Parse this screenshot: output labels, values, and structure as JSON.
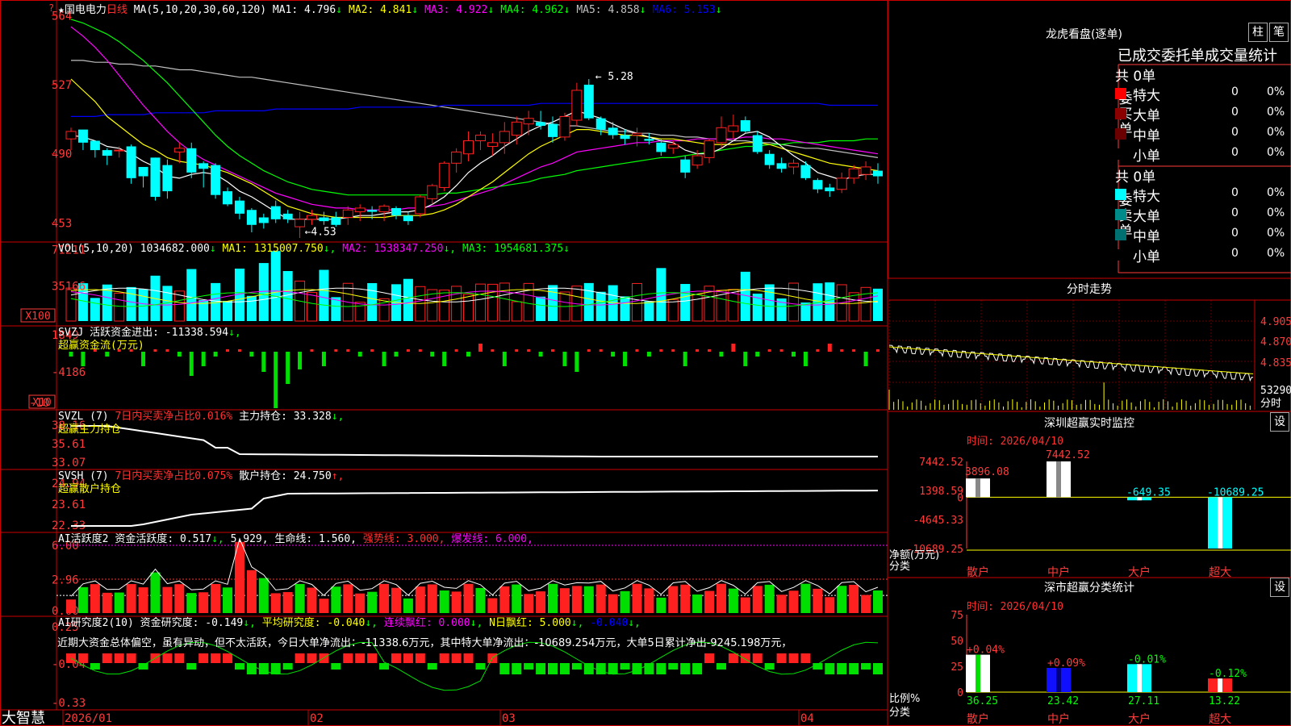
{
  "colors": {
    "up": "#ff2020",
    "down": "#00ffff",
    "grid": "#cc0000",
    "ma1": "#ffffff",
    "ma2": "#ffff00",
    "ma3": "#ff00ff",
    "ma4": "#00ff00",
    "ma5": "#c0c0c0",
    "ma6": "#0000ff"
  },
  "header": {
    "star": "★",
    "stock_name": "国电电力",
    "period": "日线",
    "ma_params": "MA(5,10,20,30,60,120)",
    "ma_values": [
      {
        "label": "MA1:",
        "value": "4.796",
        "arrow": "↓"
      },
      {
        "label": "MA2:",
        "value": "4.841",
        "arrow": "↓"
      },
      {
        "label": "MA3:",
        "value": "4.922",
        "arrow": "↓"
      },
      {
        "label": "MA4:",
        "value": "4.962",
        "arrow": "↓"
      },
      {
        "label": "MA5:",
        "value": "4.858",
        "arrow": "↓"
      },
      {
        "label": "MA6:",
        "value": "5.153",
        "arrow": "↓"
      }
    ]
  },
  "price_axis": [
    "564",
    "527",
    "490",
    "453"
  ],
  "high_label": "5.28",
  "low_label": "4.53",
  "vol": {
    "title": "VOL(5,10,20)",
    "value": "1034682.000",
    "ma1": "1315007.750",
    "ma2": "1538347.250",
    "ma3": "1954681.375",
    "axis": [
      "71211",
      "35166"
    ],
    "unit": "X100"
  },
  "svzj": {
    "title": "SVZJ",
    "label": "活跃资金进出:",
    "value": "-11338.594",
    "sub": "超赢资金流(万元)",
    "axis": [
      "1849",
      "-4186",
      "-10"
    ],
    "unit": "X10"
  },
  "svzl": {
    "title": "SVZL (7)",
    "label1": "7日内买卖净占比0.016%",
    "label2": "主力持仓:",
    "value": "33.328",
    "sub": "超赢主力持仓",
    "axis": [
      "38.16",
      "35.61",
      "33.07"
    ]
  },
  "svsh": {
    "title": "SVSH (7)",
    "label1": "7日内买卖净占比0.075%",
    "label2": "散户持仓:",
    "value": "24.750",
    "sub": "超赢散户持仓",
    "axis": [
      "24.94",
      "23.61",
      "22.33"
    ]
  },
  "ai_active": {
    "title": "AI活跃度2",
    "label": "资金活跃度:",
    "v1": "0.517",
    "v2": "5.929",
    "life_label": "生命线:",
    "life": "1.560",
    "strong_label": "强势线:",
    "strong": "3.000",
    "burst_label": "爆发线:",
    "burst": "6.000",
    "axis": [
      "6.00",
      "2.96",
      "0.00"
    ]
  },
  "ai_research": {
    "title": "AI研究度2(10)",
    "label": "资金研究度:",
    "value": "-0.149",
    "avg_label": "平均研究度:",
    "avg": "-0.040",
    "red_label": "连续飘红:",
    "red": "0.000",
    "nred_label": "N日飘红:",
    "nred": "5.000",
    "last": "-0.040",
    "comment": "近期大资金总体偏空，虽有异动，但不太活跃，今日大单净流出：-11338.6万元，其中特大单净流出：-10689.254万元，大单5日累计净出-9245.198万元，",
    "axis": [
      "0.25",
      "-0.04",
      "-0.33"
    ]
  },
  "date_axis": [
    "2026/01",
    "02",
    "03",
    "04"
  ],
  "brand": "大智慧",
  "right_top": {
    "title": "龙虎看盘(逐单)",
    "btn1": "柱",
    "btn2": "笔",
    "subtitle": "已成交委托单成交量统计",
    "buy_side": "委买单",
    "sell_side": "委卖单",
    "buy_total": "共 0单",
    "sell_total": "共 0单",
    "rows": [
      "特大",
      "大单",
      "中单",
      "小单"
    ],
    "zero": "0",
    "pct": "0%",
    "buy_colors": [
      "#ff0000",
      "#8b0000",
      "#6b0000",
      "#000000"
    ],
    "sell_colors": [
      "#00ffff",
      "#008b8b",
      "#007070",
      "#000000"
    ]
  },
  "intraday": {
    "title": "分时走势",
    "axis": [
      "4.905",
      "4.870",
      "4.835"
    ],
    "vol_label": "53290",
    "sub_label": "分时"
  },
  "sz_monitor": {
    "title": "深圳超赢实时监控",
    "btn": "设",
    "time": "时间: 2026/04/10",
    "axis": [
      "7442.52",
      "1398.59",
      "0",
      "-4645.33",
      "-10689.25"
    ],
    "ylabel1": "净额(万元)",
    "ylabel2": "分类",
    "categories": [
      "散户",
      "中户",
      "大户",
      "超大"
    ],
    "value_labels": [
      "3896.08",
      "7442.52",
      "-649.35",
      "-10689.25"
    ]
  },
  "sz_class": {
    "title": "深市超赢分类统计",
    "btn": "设",
    "time": "时间: 2026/04/10",
    "axis": [
      "75",
      "50",
      "25",
      "0"
    ],
    "ylabel1": "比例%",
    "ylabel2": "分类",
    "categories": [
      "散户",
      "中户",
      "大户",
      "超大"
    ],
    "change_labels": [
      "+0.04%",
      "+0.09%",
      "-0.01%",
      "-0.12%"
    ],
    "value_labels": [
      "36.25",
      "23.42",
      "27.11",
      "13.22"
    ]
  },
  "chart_data": {
    "type": "candlestick",
    "ylim": [
      445,
      568
    ],
    "candles": [
      [
        498,
        504,
        492,
        502
      ],
      [
        503,
        502,
        492,
        496
      ],
      [
        497,
        495,
        488,
        492
      ],
      [
        492,
        493,
        484,
        489
      ],
      [
        492,
        494,
        488,
        492
      ],
      [
        494,
        495,
        474,
        477
      ],
      [
        483,
        481,
        472,
        478
      ],
      [
        488,
        488,
        465,
        467
      ],
      [
        484,
        487,
        466,
        470
      ],
      [
        491,
        496,
        485,
        493
      ],
      [
        493,
        496,
        477,
        480
      ],
      [
        485,
        486,
        472,
        482
      ],
      [
        484,
        485,
        466,
        468
      ],
      [
        470,
        472,
        462,
        463
      ],
      [
        465,
        467,
        455,
        458
      ],
      [
        460,
        461,
        448,
        452
      ],
      [
        456,
        458,
        450,
        453
      ],
      [
        462,
        465,
        453,
        455
      ],
      [
        458,
        460,
        453,
        455
      ],
      [
        451,
        459,
        445,
        455
      ],
      [
        455,
        460,
        452,
        457
      ],
      [
        456,
        459,
        452,
        454
      ],
      [
        456,
        459,
        451,
        452
      ],
      [
        456,
        462,
        452,
        460
      ],
      [
        459,
        463,
        454,
        461
      ],
      [
        460,
        462,
        455,
        459
      ],
      [
        459,
        463,
        454,
        462
      ],
      [
        461,
        462,
        455,
        457
      ],
      [
        457,
        459,
        452,
        454
      ],
      [
        458,
        468,
        456,
        467
      ],
      [
        466,
        474,
        463,
        473
      ],
      [
        472,
        486,
        470,
        485
      ],
      [
        485,
        493,
        480,
        491
      ],
      [
        490,
        502,
        486,
        497
      ],
      [
        497,
        502,
        492,
        500
      ],
      [
        494,
        501,
        489,
        496
      ],
      [
        496,
        507,
        490,
        502
      ],
      [
        500,
        510,
        495,
        507
      ],
      [
        506,
        513,
        500,
        509
      ],
      [
        507,
        513,
        503,
        505
      ],
      [
        506,
        510,
        496,
        499
      ],
      [
        499,
        512,
        497,
        510
      ],
      [
        508,
        528,
        505,
        524
      ],
      [
        527,
        530,
        508,
        509
      ],
      [
        509,
        510,
        500,
        503
      ],
      [
        504,
        507,
        498,
        500
      ],
      [
        500,
        503,
        495,
        498
      ],
      [
        500,
        504,
        494,
        501
      ],
      [
        498,
        501,
        495,
        497
      ],
      [
        496,
        498,
        489,
        491
      ],
      [
        493,
        497,
        490,
        495
      ],
      [
        487,
        489,
        477,
        480
      ],
      [
        484,
        492,
        482,
        489
      ],
      [
        488,
        498,
        485,
        497
      ],
      [
        496,
        510,
        493,
        504
      ],
      [
        502,
        511,
        498,
        505
      ],
      [
        508,
        510,
        501,
        502
      ],
      [
        500,
        502,
        490,
        491
      ],
      [
        490,
        492,
        482,
        484
      ],
      [
        485,
        488,
        480,
        482
      ],
      [
        483,
        487,
        479,
        485
      ],
      [
        484,
        486,
        476,
        477
      ],
      [
        476,
        477,
        469,
        471
      ],
      [
        472,
        474,
        467,
        470
      ],
      [
        471,
        480,
        469,
        477
      ],
      [
        477,
        484,
        474,
        482
      ],
      [
        479,
        486,
        476,
        483
      ],
      [
        481,
        485,
        474,
        478
      ]
    ],
    "ma_lines": {
      "ma1": [
        500,
        499,
        497,
        494,
        493,
        490,
        486,
        483,
        478,
        477,
        479,
        480,
        479,
        475,
        470,
        467,
        463,
        459,
        455,
        455,
        455,
        455,
        455,
        456,
        457,
        457,
        458,
        459,
        459,
        460,
        463,
        467,
        473,
        480,
        485,
        489,
        494,
        498,
        502,
        505,
        507,
        510,
        513,
        511,
        509,
        506,
        503,
        501,
        499,
        497,
        496,
        492,
        490,
        490,
        493,
        497,
        501,
        502,
        499,
        494,
        489,
        485,
        480,
        478,
        476,
        478,
        479,
        479
      ],
      "ma2": [
        530,
        524,
        518,
        510,
        505,
        500,
        495,
        492,
        488,
        486,
        485,
        484,
        482,
        480,
        477,
        474,
        470,
        466,
        462,
        460,
        458,
        457,
        456,
        456,
        456,
        456,
        456,
        457,
        457,
        457,
        458,
        460,
        463,
        467,
        471,
        475,
        480,
        485,
        490,
        494,
        497,
        500,
        503,
        503,
        502,
        501,
        500,
        500,
        499,
        498,
        498,
        497,
        496,
        495,
        495,
        495,
        496,
        496,
        495,
        493,
        491,
        489,
        487,
        485,
        484,
        483,
        482,
        481
      ],
      "ma3": [
        558,
        553,
        547,
        540,
        532,
        524,
        516,
        509,
        502,
        496,
        491,
        487,
        484,
        481,
        478,
        475,
        472,
        469,
        467,
        465,
        463,
        462,
        461,
        461,
        460,
        460,
        460,
        460,
        461,
        461,
        462,
        463,
        465,
        467,
        469,
        471,
        474,
        477,
        480,
        483,
        485,
        488,
        491,
        492,
        493,
        494,
        495,
        496,
        496,
        497,
        497,
        497,
        498,
        498,
        498,
        498,
        499,
        499,
        498,
        498,
        497,
        496,
        495,
        494,
        493,
        492,
        491,
        490
      ],
      "ma4": [
        562,
        560,
        557,
        554,
        550,
        545,
        540,
        534,
        528,
        521,
        514,
        507,
        500,
        494,
        489,
        485,
        481,
        478,
        475,
        473,
        471,
        470,
        469,
        468,
        468,
        468,
        468,
        468,
        468,
        468,
        468,
        469,
        469,
        470,
        471,
        472,
        473,
        474,
        475,
        477,
        478,
        479,
        481,
        482,
        483,
        484,
        485,
        486,
        487,
        488,
        488,
        489,
        490,
        491,
        492,
        493,
        494,
        494,
        495,
        495,
        496,
        496,
        496,
        497,
        497,
        497,
        498,
        498
      ],
      "ma5": [
        540,
        540,
        539,
        539,
        538,
        538,
        537,
        537,
        536,
        535,
        535,
        534,
        533,
        532,
        531,
        531,
        530,
        529,
        528,
        527,
        526,
        525,
        524,
        523,
        522,
        521,
        520,
        519,
        518,
        517,
        516,
        515,
        514,
        513,
        512,
        511,
        510,
        509,
        508,
        507,
        506,
        505,
        505,
        504,
        503,
        502,
        502,
        501,
        501,
        500,
        500,
        499,
        499,
        498,
        498,
        497,
        497,
        496,
        496,
        495,
        494,
        493,
        493,
        492,
        491,
        490,
        489,
        488
      ],
      "ma6": [
        510,
        510,
        510,
        511,
        511,
        511,
        511,
        512,
        512,
        512,
        512,
        512,
        513,
        513,
        513,
        513,
        513,
        514,
        514,
        514,
        514,
        514,
        514,
        514,
        515,
        515,
        515,
        515,
        515,
        515,
        515,
        516,
        516,
        516,
        516,
        516,
        516,
        516,
        516,
        517,
        517,
        517,
        517,
        517,
        517,
        517,
        517,
        517,
        517,
        517,
        517,
        517,
        517,
        517,
        517,
        517,
        517,
        517,
        517,
        517,
        517,
        517,
        517,
        516,
        516,
        516,
        516,
        516
      ]
    }
  }
}
